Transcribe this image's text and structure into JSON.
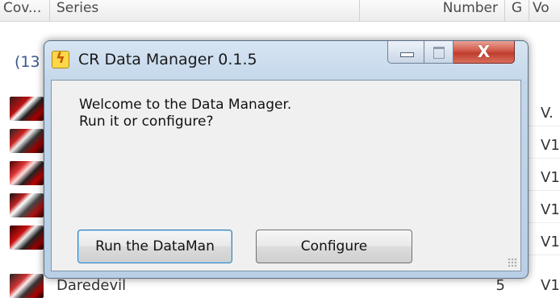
{
  "list": {
    "columns": {
      "cover": "Cov...",
      "series": "Series",
      "number": "Number",
      "g": "G",
      "volume": "Vo"
    },
    "group_label": "(13",
    "volume_column_values": [
      "V.",
      "V1",
      "V1",
      "V1",
      "V1"
    ],
    "last_row": {
      "series": "Daredevil",
      "number": "5",
      "volume": "V1"
    }
  },
  "dialog": {
    "title": "CR Data Manager 0.1.5",
    "message_line1": "Welcome to the Data Manager.",
    "message_line2": "Run it or configure?",
    "run_button": "Run the DataMan",
    "configure_button": "Configure",
    "close_glyph": "X",
    "icon": "lightning-app-icon"
  }
}
